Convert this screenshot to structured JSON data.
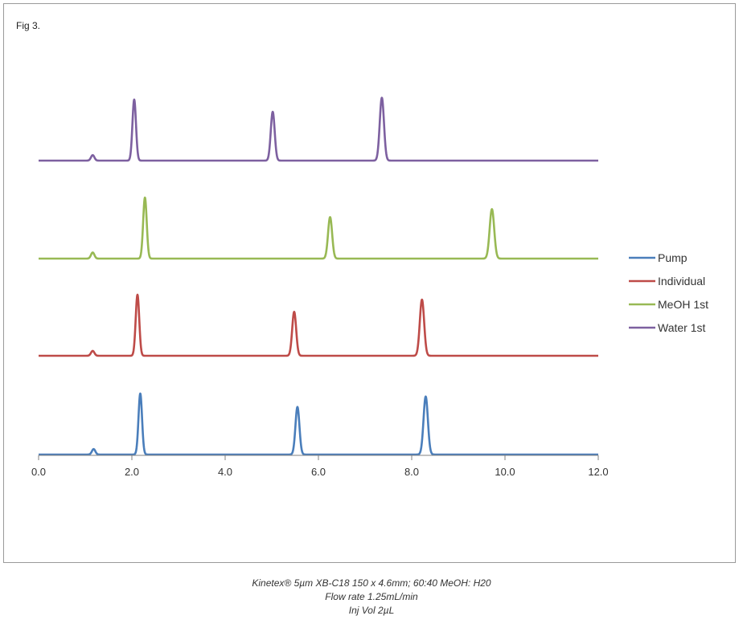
{
  "figure_label": "Fig 3.",
  "caption": [
    "Kinetex® 5µm XB-C18 150 x 4.6mm; 60:40 MeOH: H20",
    "Flow rate 1.25mL/min",
    "Inj Vol 2µL"
  ],
  "chart_data": {
    "type": "line",
    "title": "",
    "xlabel": "",
    "ylabel": "",
    "xlim": [
      0,
      12
    ],
    "x_ticks": [
      "0.0",
      "2.0",
      "4.0",
      "6.0",
      "8.0",
      "10.0",
      "12.0"
    ],
    "y_axis_visible": false,
    "grid": false,
    "legend_position": "right",
    "series": [
      {
        "name": "Pump",
        "color": "#4A7EBB",
        "baseline_order": 0,
        "peaks": [
          {
            "x": 1.18,
            "height": 0.09
          },
          {
            "x": 2.18,
            "height": 1.0
          },
          {
            "x": 5.55,
            "height": 0.78
          },
          {
            "x": 8.3,
            "height": 0.95
          }
        ]
      },
      {
        "name": "Individual",
        "color": "#BE4B48",
        "baseline_order": 1,
        "peaks": [
          {
            "x": 1.16,
            "height": 0.08
          },
          {
            "x": 2.12,
            "height": 1.0
          },
          {
            "x": 5.48,
            "height": 0.72
          },
          {
            "x": 8.22,
            "height": 0.92
          }
        ]
      },
      {
        "name": "MeOH 1st",
        "color": "#98B954",
        "baseline_order": 2,
        "peaks": [
          {
            "x": 1.16,
            "height": 0.1
          },
          {
            "x": 2.28,
            "height": 1.0
          },
          {
            "x": 6.25,
            "height": 0.68
          },
          {
            "x": 9.72,
            "height": 0.81
          }
        ]
      },
      {
        "name": "Water 1st",
        "color": "#7D60A0",
        "baseline_order": 3,
        "peaks": [
          {
            "x": 1.16,
            "height": 0.09
          },
          {
            "x": 2.05,
            "height": 1.0
          },
          {
            "x": 5.02,
            "height": 0.8
          },
          {
            "x": 7.36,
            "height": 1.03
          }
        ]
      }
    ]
  }
}
